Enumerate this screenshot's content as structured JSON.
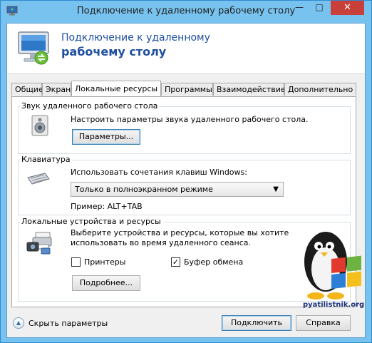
{
  "window": {
    "title": "Подключение к удаленному рабочему столу",
    "min_glyph": "—",
    "max_glyph": "□",
    "close_glyph": "✕"
  },
  "banner": {
    "line1": "Подключение к удаленному",
    "line2": "рабочему столу"
  },
  "tabs": [
    {
      "label": "Общие",
      "active": false
    },
    {
      "label": "Экран",
      "active": false
    },
    {
      "label": "Локальные ресурсы",
      "active": true
    },
    {
      "label": "Программы",
      "active": false
    },
    {
      "label": "Взаимодействие",
      "active": false
    },
    {
      "label": "Дополнительно",
      "active": false
    }
  ],
  "sound": {
    "legend": "Звук удаленного рабочего стола",
    "description": "Настроить параметры звука удаленного рабочего стола.",
    "button": "Параметры...",
    "icon": "speaker-icon"
  },
  "keyboard": {
    "legend": "Клавиатура",
    "description": "Использовать сочетания клавиш Windows:",
    "selected": "Только в полноэкранном режиме",
    "example": "Пример: ALT+TAB",
    "icon": "keyboard-icon"
  },
  "devices": {
    "legend": "Локальные устройства и ресурсы",
    "description_line1": "Выберите устройства и ресурсы, которые вы хотите",
    "description_line2": "использовать во время удаленного сеанса.",
    "printers_label": "Принтеры",
    "printers_checked": false,
    "clipboard_label": "Буфер обмена",
    "clipboard_checked": true,
    "more_button": "Подробнее...",
    "icon": "devices-icon"
  },
  "footer": {
    "hide_options": "Скрыть параметры",
    "connect": "Подключить",
    "help": "Справка"
  },
  "watermark": {
    "text": "pyatilistnik.org"
  },
  "colors": {
    "title_bar": "#78c2ef",
    "banner_text": "#1e4fa0",
    "close_button": "#c9403a"
  }
}
